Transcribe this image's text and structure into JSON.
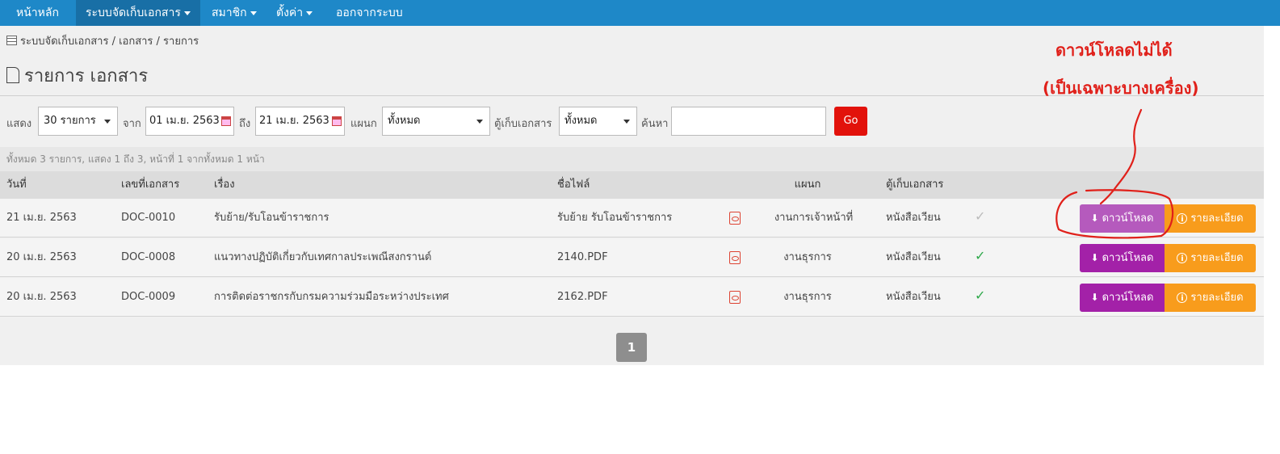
{
  "navbar": {
    "items": [
      {
        "label": "หน้าหลัก",
        "dropdown": false
      },
      {
        "label": "ระบบจัดเก็บเอกสาร",
        "dropdown": true
      },
      {
        "label": "สมาชิก",
        "dropdown": true
      },
      {
        "label": "ตั้งค่า",
        "dropdown": true
      },
      {
        "label": "ออกจากระบบ",
        "dropdown": false
      }
    ]
  },
  "breadcrumb": "ระบบจัดเก็บเอกสาร / เอกสาร / รายการ",
  "page_title": "รายการ เอกสาร",
  "filters": {
    "show_label": "แสดง",
    "show_value": "30 รายการ",
    "from_label": "จาก",
    "from_date": "01 เม.ย. 2563",
    "to_label": "ถึง",
    "to_date": "21 เม.ย. 2563",
    "dept_label": "แผนก",
    "dept_value": "ทั้งหมด",
    "cabinet_label": "ตู้เก็บเอกสาร",
    "cabinet_value": "ทั้งหมด",
    "search_label": "ค้นหา",
    "search_value": "",
    "go_label": "Go"
  },
  "summary": "ทั้งหมด 3 รายการ, แสดง 1 ถึง 3, หน้าที่ 1 จากทั้งหมด 1 หน้า",
  "table": {
    "headers": {
      "date": "วันที่",
      "doc_no": "เลขที่เอกสาร",
      "subject": "เรื่อง",
      "filename": "ชื่อไฟล์",
      "department": "แผนก",
      "cabinet": "ตู้เก็บเอกสาร"
    },
    "rows": [
      {
        "date": "21 เม.ย. 2563",
        "doc_no": "DOC-0010",
        "subject": "รับย้าย/รับโอนข้าราชการ",
        "filename": "รับย้าย รับโอนข้าราชการ",
        "department": "งานการเจ้าหน้าที่",
        "cabinet": "หนังสือเวียน",
        "checked": false
      },
      {
        "date": "20 เม.ย. 2563",
        "doc_no": "DOC-0008",
        "subject": "แนวทางปฏิบัติเกี่ยวกับเทศกาลประเพณีสงกรานต์",
        "filename": "2140.PDF",
        "department": "งานธุรการ",
        "cabinet": "หนังสือเวียน",
        "checked": true
      },
      {
        "date": "20 เม.ย. 2563",
        "doc_no": "DOC-0009",
        "subject": "การติดต่อราชกรกับกรมความร่วมมือระหว่างประเทศ",
        "filename": "2162.PDF",
        "department": "งานธุรการ",
        "cabinet": "หนังสือเวียน",
        "checked": true
      }
    ],
    "download_label": "ดาวน์โหลด",
    "details_label": "รายละเอียด"
  },
  "pagination": {
    "current": "1"
  },
  "annotation": {
    "line1": "ดาวน์โหลดไม่ได้",
    "line2": "(เป็นเฉพาะบางเครื่อง)",
    "color": "#e0201a"
  },
  "colors": {
    "navbar": "#1e88c8",
    "download": "#a321a8",
    "details": "#f89c1c",
    "go": "#e2120b",
    "check_green": "#2ea84a",
    "check_grey": "#bbbbbb"
  }
}
